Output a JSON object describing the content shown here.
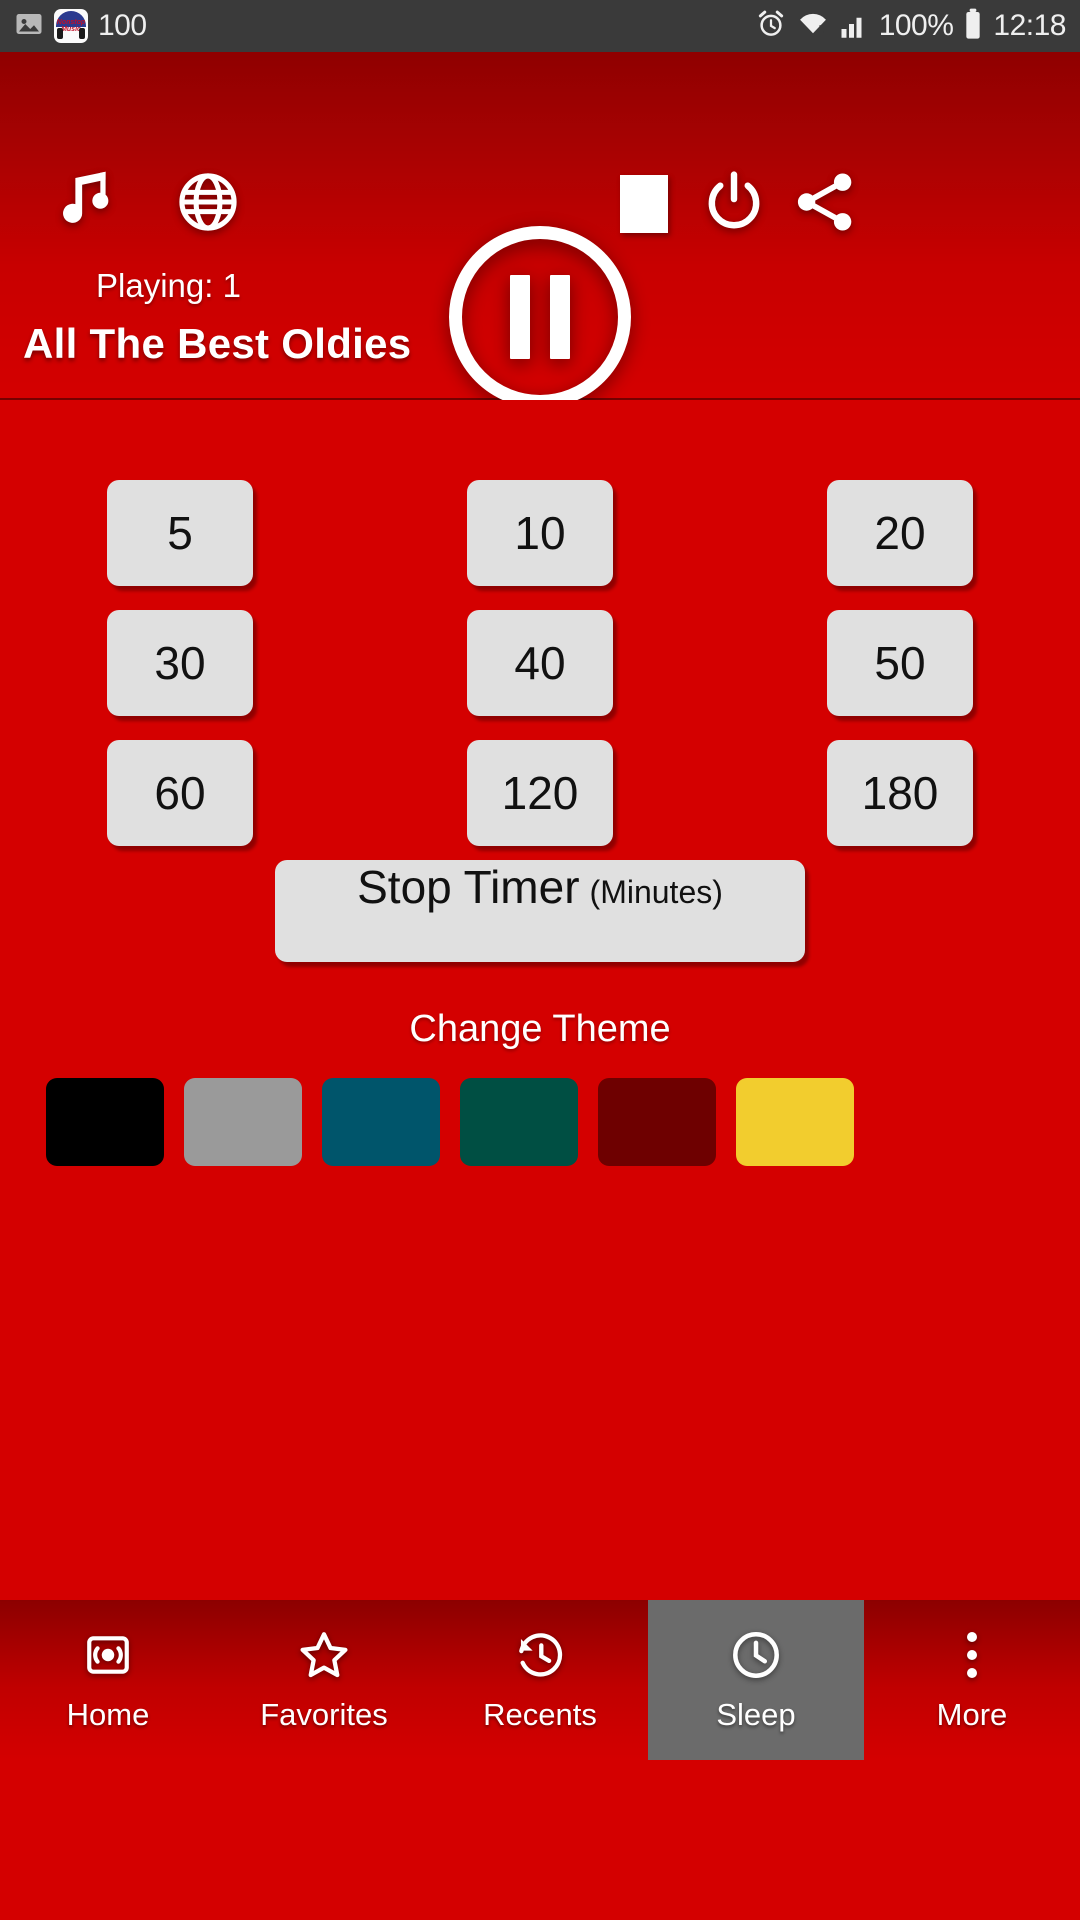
{
  "status_bar": {
    "image_icon": "image-icon",
    "app_badge_line1": "Nonstop",
    "app_badge_line2": "Music",
    "notification_count": "100",
    "alarm_icon": "alarm-icon",
    "wifi_icon": "wifi-icon",
    "signal_icon": "signal-icon",
    "battery_percent": "100%",
    "battery_icon": "battery-icon",
    "clock": "12:18"
  },
  "player": {
    "music_icon": "music-note-icon",
    "globe_icon": "globe-icon",
    "playpause_icon": "pause-icon",
    "stop_icon": "stop-icon",
    "power_icon": "power-icon",
    "share_icon": "share-icon",
    "playing_label": "Playing: 1",
    "station_title": "All The Best Oldies"
  },
  "sleep_timer": {
    "options": [
      "5",
      "10",
      "20",
      "30",
      "40",
      "50",
      "60",
      "120",
      "180"
    ],
    "stop_timer_main": "Stop Timer",
    "stop_timer_sub": "(Minutes)"
  },
  "theme": {
    "label": "Change Theme",
    "swatches": [
      {
        "name": "black",
        "color": "#000000"
      },
      {
        "name": "gray",
        "color": "#9a9a9a"
      },
      {
        "name": "blue",
        "color": "#00556b"
      },
      {
        "name": "green",
        "color": "#004f43"
      },
      {
        "name": "maroon",
        "color": "#6e0000"
      },
      {
        "name": "yellow",
        "color": "#f2cd2e"
      }
    ]
  },
  "bottom_nav": {
    "items": [
      {
        "label": "Home",
        "icon": "radio-icon",
        "selected": false
      },
      {
        "label": "Favorites",
        "icon": "star-icon",
        "selected": false
      },
      {
        "label": "Recents",
        "icon": "history-clock-icon",
        "selected": false
      },
      {
        "label": "Sleep",
        "icon": "clock-icon",
        "selected": true
      },
      {
        "label": "More",
        "icon": "more-vert-icon",
        "selected": false
      }
    ]
  },
  "colors": {
    "background_red": "#d40000",
    "header_dark_red": "#8f0000",
    "button_gray": "#e0e0e0",
    "selected_nav": "#6b6b6b",
    "status_bar": "#3a3a3a"
  }
}
